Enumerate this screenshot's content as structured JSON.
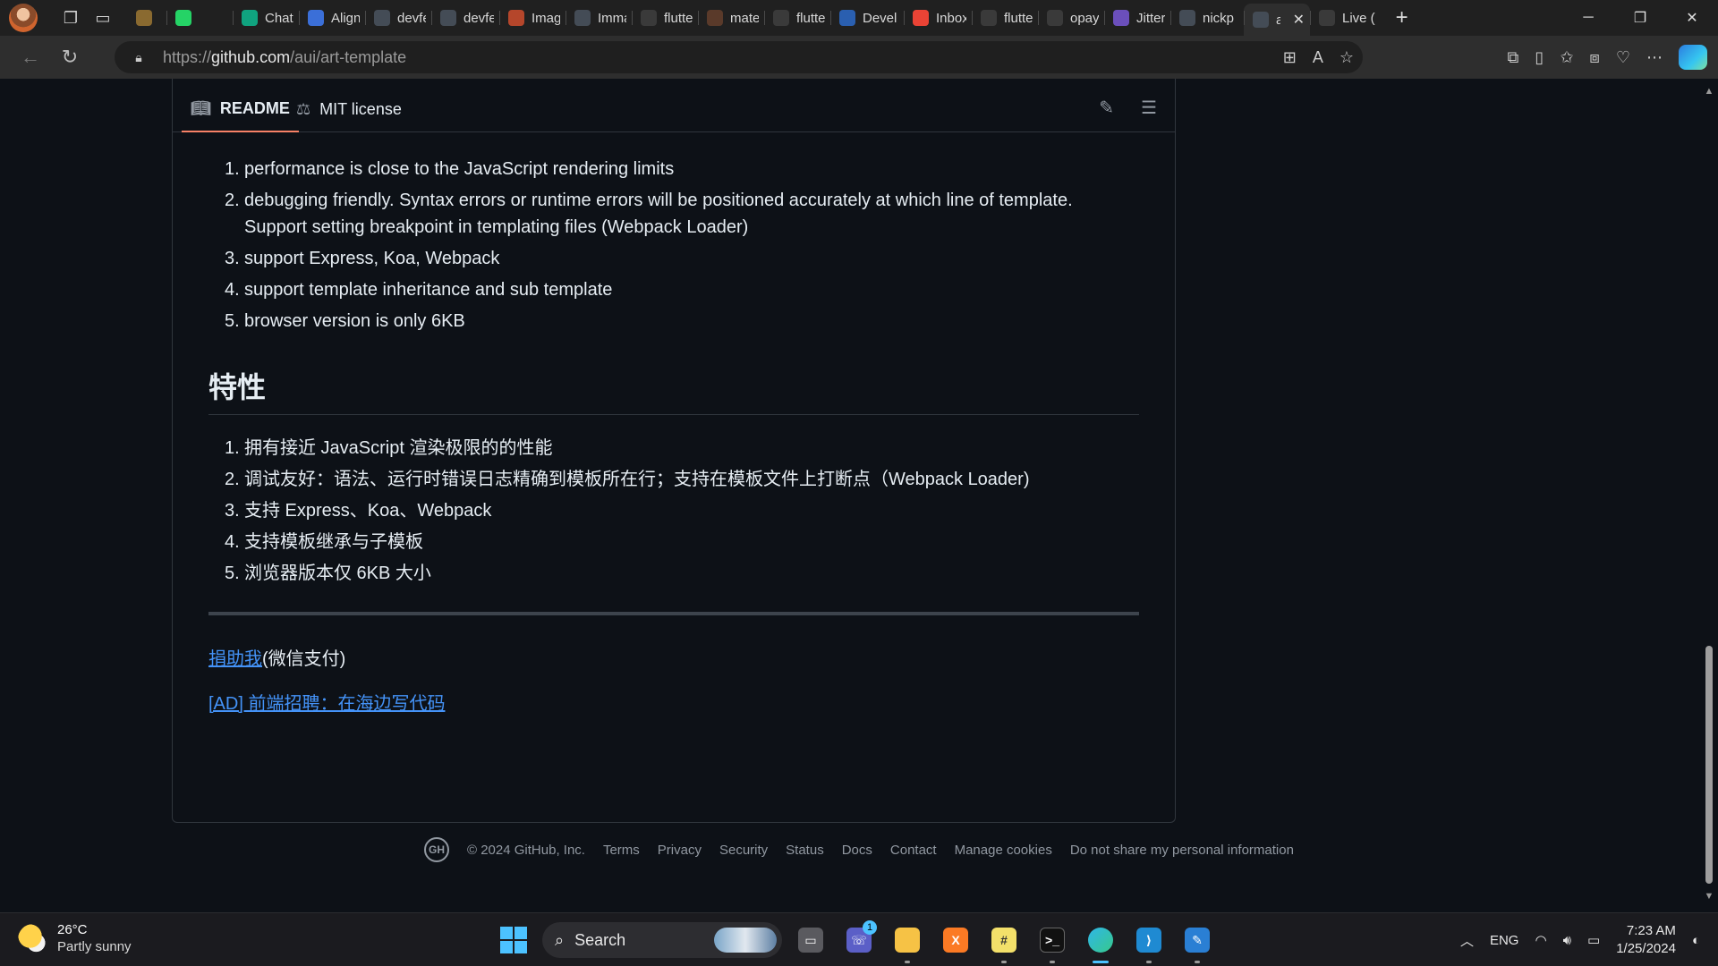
{
  "browser": {
    "tabs": [
      {
        "title": "",
        "fav_color": "#8a6a30",
        "icon": "notebook-icon"
      },
      {
        "title": "",
        "fav_color": "#25d366",
        "icon": "whatsapp-icon"
      },
      {
        "title": "Chat(",
        "fav_color": "#10a37f",
        "icon": "chatgpt-icon"
      },
      {
        "title": "Align",
        "fav_color": "#3b6fd8",
        "icon": "flutter-icon"
      },
      {
        "title": "devfe",
        "fav_color": "#444c56",
        "icon": "github-icon"
      },
      {
        "title": "devfe",
        "fav_color": "#444c56",
        "icon": "github-icon"
      },
      {
        "title": "Imag",
        "fav_color": "#b5462b",
        "icon": "brush-icon"
      },
      {
        "title": "Imma",
        "fav_color": "#444c56",
        "icon": "github-icon"
      },
      {
        "title": "flutte",
        "fav_color": "#3a3a3a",
        "icon": "search-icon"
      },
      {
        "title": "mater",
        "fav_color": "#5a3a2a",
        "icon": "brush-icon"
      },
      {
        "title": "flutte",
        "fav_color": "#3a3a3a",
        "icon": "search-icon"
      },
      {
        "title": "Devel",
        "fav_color": "#2a5fb0",
        "icon": "dev-icon"
      },
      {
        "title": "Inbox",
        "fav_color": "#ea4335",
        "icon": "gmail-icon"
      },
      {
        "title": "flutte",
        "fav_color": "#3a3a3a",
        "icon": "search-icon"
      },
      {
        "title": "opay",
        "fav_color": "#3a3a3a",
        "icon": "search-icon"
      },
      {
        "title": "Jitter",
        "fav_color": "#6b4fbb",
        "icon": "jitter-icon"
      },
      {
        "title": "nickp",
        "fav_color": "#444c56",
        "icon": "github-icon"
      },
      {
        "title": "a",
        "fav_color": "#444c56",
        "icon": "github-icon",
        "active": true
      },
      {
        "title": "Live (",
        "fav_color": "#3a3a3a",
        "icon": "page-icon"
      }
    ],
    "url_prefix": "https://",
    "url_host": "github.com",
    "url_path": "/aui/art-template"
  },
  "readme": {
    "tab_readme": "README",
    "tab_license": "MIT license",
    "features_en": [
      {
        "n": "1.",
        "text": "performance is close to the JavaScript rendering limits"
      },
      {
        "n": "2.",
        "text": "debugging friendly. Syntax errors or runtime errors will be positioned accurately at which line of template. Support setting breakpoint in templating files (Webpack Loader)"
      },
      {
        "n": "3.",
        "text": "support Express, Koa, Webpack"
      },
      {
        "n": "4.",
        "text": "support template inheritance and sub template"
      },
      {
        "n": "5.",
        "text": "browser version is only 6KB"
      }
    ],
    "heading_zh": "特性",
    "features_zh": [
      {
        "n": "1.",
        "text": "拥有接近 JavaScript 渲染极限的的性能"
      },
      {
        "n": "2.",
        "text": "调试友好：语法、运行时错误日志精确到模板所在行；支持在模板文件上打断点（Webpack Loader)"
      },
      {
        "n": "3.",
        "text": "支持 Express、Koa、Webpack"
      },
      {
        "n": "4.",
        "text": "支持模板继承与子模板"
      },
      {
        "n": "5.",
        "text": "浏览器版本仅 6KB 大小"
      }
    ],
    "donate_link": "捐助我",
    "donate_suffix": "(微信支付)",
    "ad_link": "[AD] 前端招聘：在海边写代码"
  },
  "footer": {
    "copyright": "© 2024 GitHub, Inc.",
    "links": [
      "Terms",
      "Privacy",
      "Security",
      "Status",
      "Docs",
      "Contact",
      "Manage cookies",
      "Do not share my personal information"
    ]
  },
  "taskbar": {
    "temp": "26°C",
    "weather": "Partly sunny",
    "search": "Search",
    "teams_badge": "1",
    "lang": "ENG",
    "time": "7:23 AM",
    "date": "1/25/2024"
  }
}
